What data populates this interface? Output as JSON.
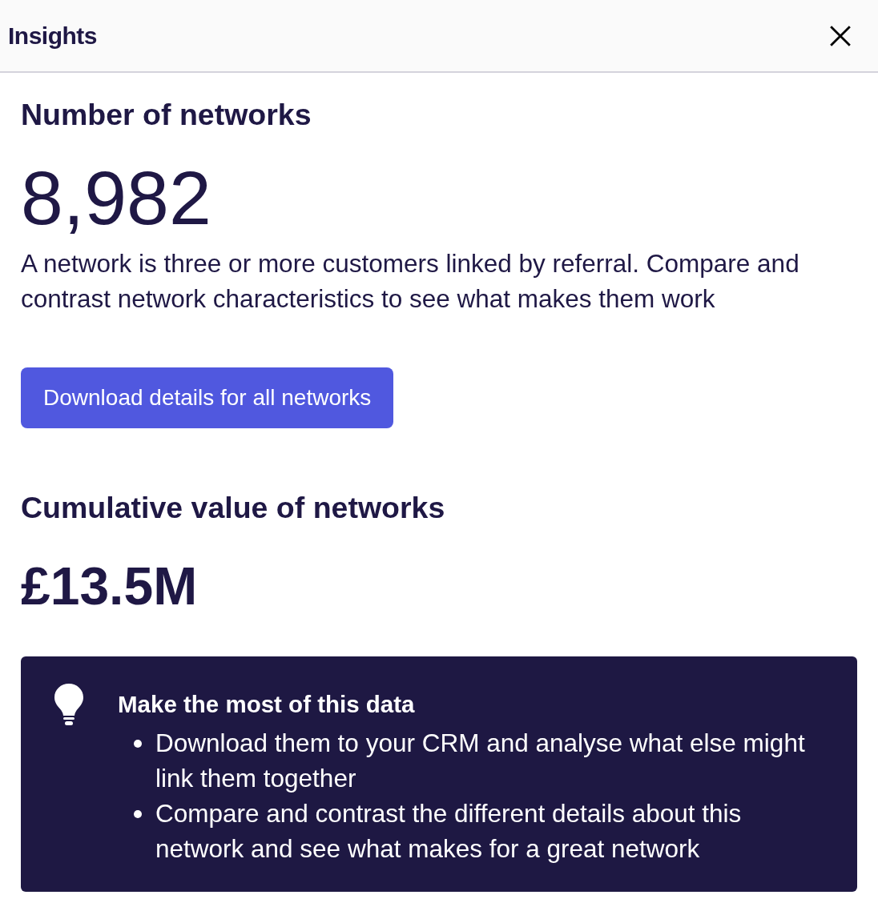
{
  "header": {
    "title": "Insights"
  },
  "networks": {
    "heading": "Number of networks",
    "value": "8,982",
    "description": "A network is three or more customers linked by referral. Compare and contrast network characteristics to see what makes them work",
    "button": "Download details for all networks"
  },
  "cumulative": {
    "heading": "Cumulative value of networks",
    "value": "£13.5M"
  },
  "tip": {
    "title": "Make the most of this data",
    "items": [
      "Download them to your CRM and analyse what else might link them together",
      "Compare and contrast the different details about this network and see what makes for a great network"
    ]
  }
}
